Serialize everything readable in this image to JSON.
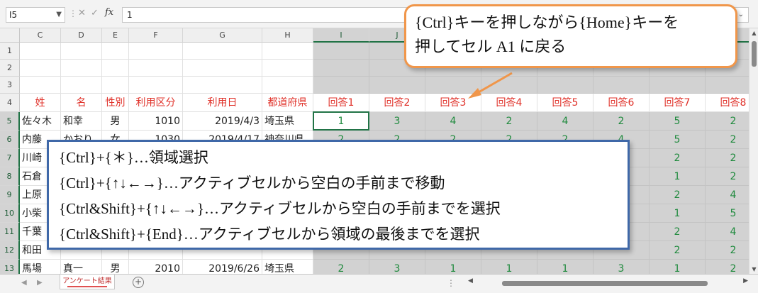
{
  "formula_bar": {
    "name_box": "I5",
    "value": "1",
    "fx_label": "fx"
  },
  "columns": [
    {
      "label": "C",
      "w": 58
    },
    {
      "label": "D",
      "w": 58
    },
    {
      "label": "E",
      "w": 38
    },
    {
      "label": "F",
      "w": 76
    },
    {
      "label": "G",
      "w": 112
    },
    {
      "label": "H",
      "w": 72
    },
    {
      "label": "I",
      "w": 79,
      "sel": true
    },
    {
      "label": "J",
      "w": 79,
      "sel": true
    },
    {
      "label": "K",
      "w": 79,
      "sel": true
    },
    {
      "label": "L",
      "w": 79,
      "sel": true
    },
    {
      "label": "M",
      "w": 79,
      "sel": true
    },
    {
      "label": "N",
      "w": 79,
      "sel": true
    },
    {
      "label": "O",
      "w": 79,
      "sel": true
    },
    {
      "label": "P",
      "w": 79,
      "sel": true
    }
  ],
  "rows": [
    {
      "n": "1",
      "cells": []
    },
    {
      "n": "2",
      "cells": []
    },
    {
      "n": "3",
      "cells": []
    },
    {
      "n": "4",
      "header": true,
      "cells": [
        "姓",
        "名",
        "性別",
        "利用区分",
        "利用日",
        "都道府県",
        "回答1",
        "回答2",
        "回答3",
        "回答4",
        "回答5",
        "回答6",
        "回答7",
        "回答8"
      ]
    },
    {
      "n": "5",
      "sel": true,
      "cells": [
        "佐々木",
        "和幸",
        "男",
        "1010",
        "2019/4/3",
        "埼玉県",
        "1",
        "3",
        "4",
        "2",
        "4",
        "2",
        "5",
        "2"
      ]
    },
    {
      "n": "6",
      "sel": true,
      "cells": [
        "内藤",
        "かおり",
        "女",
        "1030",
        "2019/4/17",
        "神奈川県",
        "2",
        "2",
        "2",
        "2",
        "2",
        "4",
        "5",
        "2"
      ]
    },
    {
      "n": "7",
      "sel": true,
      "cells": [
        "川崎",
        "",
        "",
        "",
        "",
        "",
        "",
        "",
        "",
        "",
        "",
        "",
        "2",
        "2"
      ]
    },
    {
      "n": "8",
      "sel": true,
      "cells": [
        "石倉",
        "",
        "",
        "",
        "",
        "",
        "",
        "",
        "",
        "",
        "",
        "",
        "1",
        "2"
      ]
    },
    {
      "n": "9",
      "sel": true,
      "cells": [
        "上原",
        "",
        "",
        "",
        "",
        "",
        "",
        "",
        "",
        "",
        "",
        "",
        "2",
        "4"
      ]
    },
    {
      "n": "10",
      "sel": true,
      "cells": [
        "小柴",
        "",
        "",
        "",
        "",
        "",
        "",
        "",
        "",
        "",
        "",
        "",
        "1",
        "5"
      ]
    },
    {
      "n": "11",
      "sel": true,
      "cells": [
        "千葉",
        "",
        "",
        "",
        "",
        "",
        "",
        "",
        "",
        "",
        "",
        "",
        "2",
        "4"
      ]
    },
    {
      "n": "12",
      "sel": true,
      "cells": [
        "和田",
        "",
        "",
        "",
        "",
        "",
        "",
        "",
        "",
        "",
        "",
        "",
        "2",
        "2"
      ]
    },
    {
      "n": "13",
      "sel": true,
      "cells": [
        "馬場",
        "真一",
        "男",
        "2010",
        "2019/6/26",
        "埼玉県",
        "2",
        "3",
        "1",
        "1",
        "1",
        "3",
        "1",
        "2"
      ]
    }
  ],
  "callout_orange": {
    "line1": "{Ctrl}キーを押しながら{Home}キーを",
    "line2": "押してセル A1 に戻る"
  },
  "callout_blue": {
    "line1": "{Ctrl}+{＊}…領域選択",
    "line2": "{Ctrl}+{↑↓←→}…アクティブセルから空白の手前まで移動",
    "line3": "{Ctrl&Shift}+{↑↓←→}…アクティブセルから空白の手前までを選択",
    "line4": "{Ctrl&Shift}+{End}…アクティブセルから領域の最後までを選択"
  },
  "sheet_tab": "アンケート結果",
  "colors": {
    "accent": "#217346",
    "header_text": "#e0322a",
    "answer_text": "#1f8a3d",
    "orange": "#f0964a",
    "blue": "#3f68a8"
  }
}
